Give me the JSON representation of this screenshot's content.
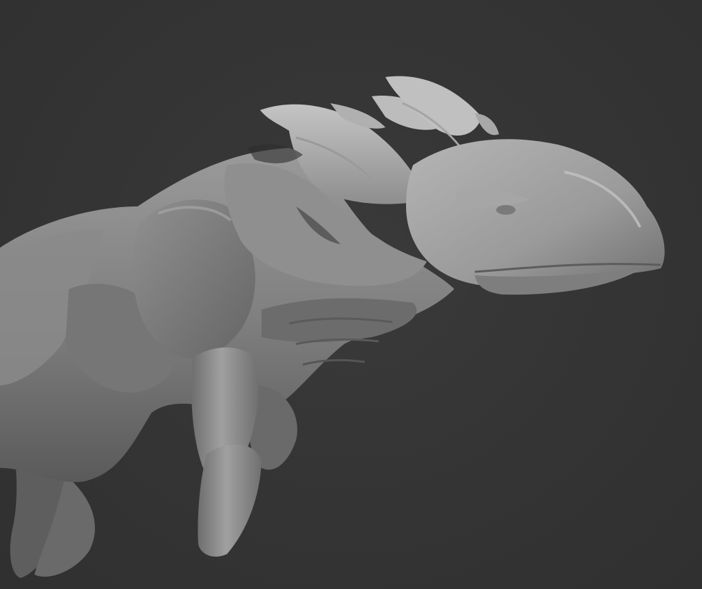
{
  "viewport": {
    "background_color": "#353535",
    "model_material_color": "#8c8c8c",
    "subject": "creature-sculpt"
  }
}
